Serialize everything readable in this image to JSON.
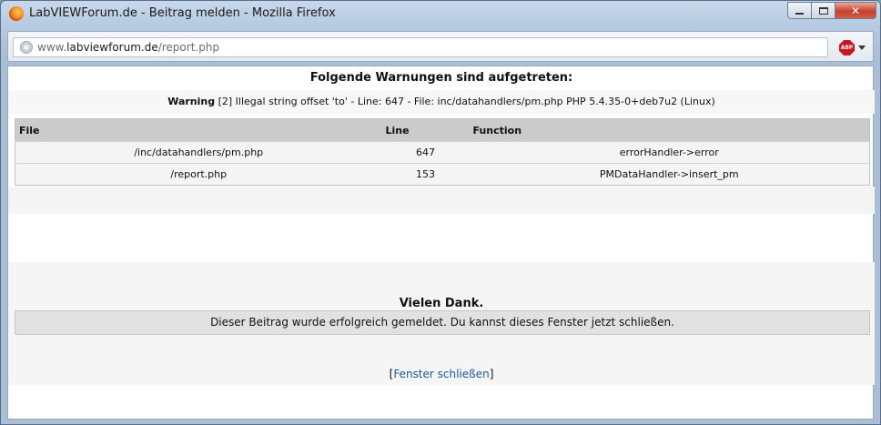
{
  "window": {
    "title": "LabVIEWForum.de - Beitrag melden - Mozilla Firefox",
    "minimize_icon": "minimize-icon",
    "maximize_icon": "maximize-icon",
    "close_icon": "close-icon",
    "close_glyph": "✕"
  },
  "urlbar": {
    "domain_prefix": "www.",
    "domain": "labviewforum.de",
    "path": "/report.php",
    "addon_label": "ABP"
  },
  "page": {
    "heading": "Folgende Warnungen sind aufgetreten:",
    "warning": {
      "label": "Warning",
      "text": " [2] Illegal string offset 'to' - Line: 647 - File: inc/datahandlers/pm.php PHP 5.4.35-0+deb7u2 (Linux)"
    },
    "trace": {
      "headers": [
        "File",
        "Line",
        "Function"
      ],
      "rows": [
        {
          "file": "/inc/datahandlers/pm.php",
          "line": "647",
          "function": "errorHandler->error"
        },
        {
          "file": "/report.php",
          "line": "153",
          "function": "PMDataHandler->insert_pm"
        }
      ]
    },
    "thanks": "Vielen Dank.",
    "success_message": "Dieser Beitrag wurde erfolgreich gemeldet. Du kannst dieses Fenster jetzt schließen.",
    "close_link": {
      "open_bracket": "[",
      "label": "Fenster schließen",
      "close_bracket": "]"
    }
  },
  "colors": {
    "link": "#1a5aa0",
    "table_header": "#cbcbcb",
    "success_box": "#e1e1e1"
  }
}
